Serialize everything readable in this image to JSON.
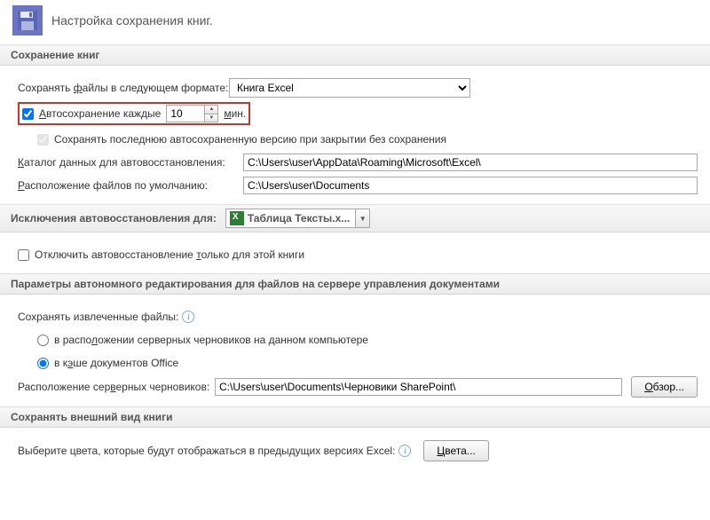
{
  "header": {
    "title": "Настройка сохранения книг."
  },
  "sections": {
    "save_books": "Сохранение книг",
    "recovery_exceptions": "Исключения автовосстановления для:",
    "offline_editing": "Параметры автономного редактирования для файлов на сервере управления документами",
    "appearance": "Сохранять внешний вид книги"
  },
  "save": {
    "format_label_pre": "Сохранять ",
    "format_label_u": "ф",
    "format_label_post": "айлы в следующем формате:",
    "format_value": "Книга Excel",
    "autosave_u": "А",
    "autosave_post": "втосохранение каждые",
    "autosave_value": "10",
    "autosave_unit_u": "м",
    "autosave_unit_post": "ин.",
    "keep_last_label": "Сохранять последнюю автосохраненную версию при закрытии без сохранения",
    "recovery_dir_pre": "",
    "recovery_dir_u": "К",
    "recovery_dir_post": "аталог данных для автовосстановления:",
    "recovery_dir_value": "C:\\Users\\user\\AppData\\Roaming\\Microsoft\\Excel\\",
    "default_loc_u": "Р",
    "default_loc_post": "асположение файлов по умолчанию:",
    "default_loc_value": "C:\\Users\\user\\Documents"
  },
  "exceptions": {
    "workbook_name": "Таблица Тексты.x...",
    "disable_pre": "Отключить автовосстановление ",
    "disable_u": "т",
    "disable_post": "олько для этой книги"
  },
  "offline": {
    "save_checked_label": "Сохранять извлеченные файлы:",
    "opt_drafts_pre": "в распо",
    "opt_drafts_u": "л",
    "opt_drafts_post": "ожении серверных черновиков на данном компьютере",
    "opt_cache_pre": "в к",
    "opt_cache_u": "э",
    "opt_cache_post": "ше документов Office",
    "drafts_loc_pre": "Расположение сер",
    "drafts_loc_u": "в",
    "drafts_loc_post": "ерных черновиков:",
    "drafts_loc_value": "C:\\Users\\user\\Documents\\Черновики SharePoint\\",
    "browse_u": "О",
    "browse_post": "бзор..."
  },
  "appearance": {
    "prompt": "Выберите цвета, которые будут отображаться в предыдущих версиях Excel:",
    "colors_u": "Ц",
    "colors_post": "вета..."
  }
}
